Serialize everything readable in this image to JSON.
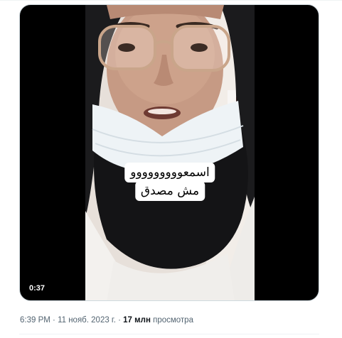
{
  "video": {
    "duration": "0:37",
    "caption_lines": [
      "اسمعووووووووو",
      "مش مصدق"
    ]
  },
  "meta": {
    "time": "6:39 PM",
    "sep1": " · ",
    "date": "11 нояб. 2023 г.",
    "sep2": " · ",
    "views_count": "17 млн",
    "views_label": " просмотра"
  },
  "colors": {
    "secondary_text": "#536471",
    "primary_text": "#0f1419",
    "border": "#cfd9de"
  }
}
